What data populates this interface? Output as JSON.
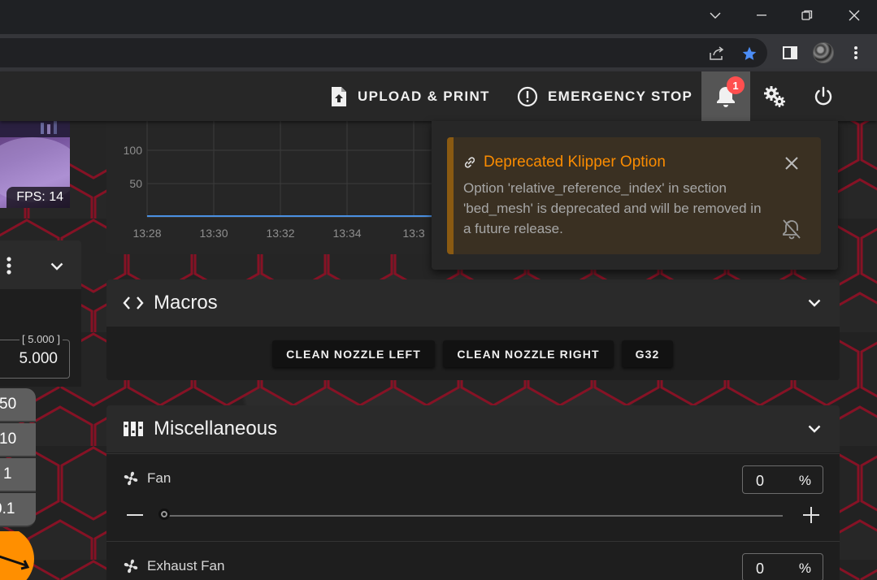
{
  "browser": {
    "window_controls": [
      "chevron-down-icon",
      "minimize-icon",
      "restore-icon",
      "close-icon"
    ],
    "toolbar_icons": [
      "share-icon",
      "star-icon",
      "side-panel-icon",
      "profile-avatar",
      "kebab-menu-icon"
    ],
    "star_color": "#4c8df6"
  },
  "appbar": {
    "upload_label": "UPLOAD & PRINT",
    "emergency_label": "EMERGENCY STOP",
    "notification_count": "1",
    "badge_color": "#ff4f4f"
  },
  "webcam": {
    "fps_label": "FPS: 14"
  },
  "left_panel": {
    "field_legend": "[ 5.000 ]",
    "field_value": "5.000",
    "steps": [
      "50",
      "10",
      "1",
      "0.1"
    ]
  },
  "chart": {
    "y_ticks": [
      "100",
      "50"
    ],
    "x_ticks": [
      "13:28",
      "13:30",
      "13:32",
      "13:34",
      "13:3"
    ],
    "line_color": "#4a90e2"
  },
  "notification": {
    "title": "Deprecated Klipper Option",
    "body": "Option 'relative_reference_index' in section 'bed_mesh' is deprecated and will be removed in a future release.",
    "title_color": "#fb8c00"
  },
  "macros": {
    "title": "Macros",
    "buttons": [
      "CLEAN NOZZLE LEFT",
      "CLEAN NOZZLE RIGHT",
      "G32"
    ]
  },
  "misc": {
    "title": "Miscellaneous",
    "fans": [
      {
        "name": "Fan",
        "value": "0",
        "unit": "%",
        "level": 0
      },
      {
        "name": "Exhaust Fan",
        "value": "0",
        "unit": "%",
        "level": 0
      }
    ]
  },
  "accent_colors": {
    "hex_red": "#c4122f",
    "warning_bg": "#3a3022"
  }
}
